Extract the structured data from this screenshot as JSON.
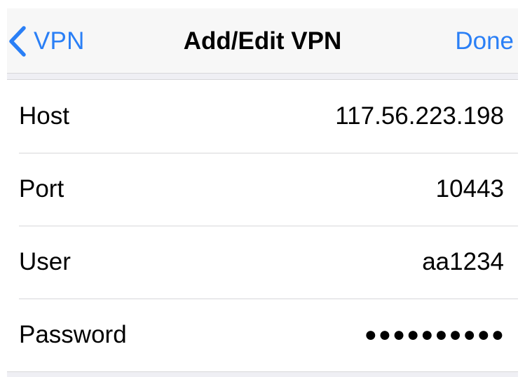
{
  "navbar": {
    "back_label": "VPN",
    "title": "Add/Edit VPN",
    "done_label": "Done",
    "back_icon": "chevron-left-icon",
    "accent_color": "#2a7ff6"
  },
  "fields": [
    {
      "label": "Host",
      "value": "117.56.223.198"
    },
    {
      "label": "Port",
      "value": "10443"
    },
    {
      "label": "User",
      "value": "aa1234"
    },
    {
      "label": "Password",
      "value": "●●●●●●●●●●"
    }
  ]
}
